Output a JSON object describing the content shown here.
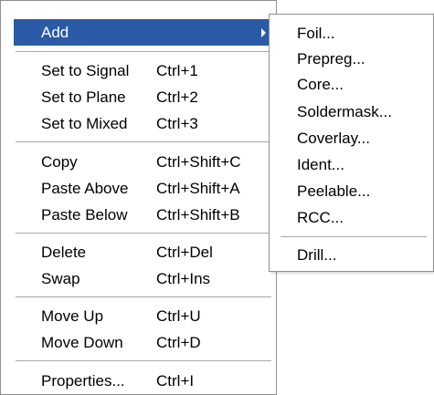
{
  "menu": {
    "add": {
      "label": "Add",
      "highlighted": true,
      "has_submenu": true,
      "arrow_icon": "chevron-right-icon"
    },
    "set_to_signal": {
      "label": "Set to Signal",
      "shortcut": "Ctrl+1"
    },
    "set_to_plane": {
      "label": "Set to Plane",
      "shortcut": "Ctrl+2"
    },
    "set_to_mixed": {
      "label": "Set to Mixed",
      "shortcut": "Ctrl+3"
    },
    "copy": {
      "label": "Copy",
      "shortcut": "Ctrl+Shift+C"
    },
    "paste_above": {
      "label": "Paste Above",
      "shortcut": "Ctrl+Shift+A"
    },
    "paste_below": {
      "label": "Paste Below",
      "shortcut": "Ctrl+Shift+B"
    },
    "delete": {
      "label": "Delete",
      "shortcut": "Ctrl+Del"
    },
    "swap": {
      "label": "Swap",
      "shortcut": "Ctrl+Ins"
    },
    "move_up": {
      "label": "Move Up",
      "shortcut": "Ctrl+U"
    },
    "move_down": {
      "label": "Move Down",
      "shortcut": "Ctrl+D"
    },
    "properties": {
      "label": "Properties...",
      "shortcut": "Ctrl+I"
    }
  },
  "submenu": {
    "foil": "Foil...",
    "prepreg": "Prepreg...",
    "core": "Core...",
    "soldermask": "Soldermask...",
    "coverlay": "Coverlay...",
    "ident": "Ident...",
    "peelable": "Peelable...",
    "rcc": "RCC...",
    "drill": "Drill..."
  },
  "colors": {
    "highlight": "#2b5aa6",
    "highlight_text": "#ffffff",
    "border": "#8f8f8f",
    "separator": "#a8a8a8"
  }
}
